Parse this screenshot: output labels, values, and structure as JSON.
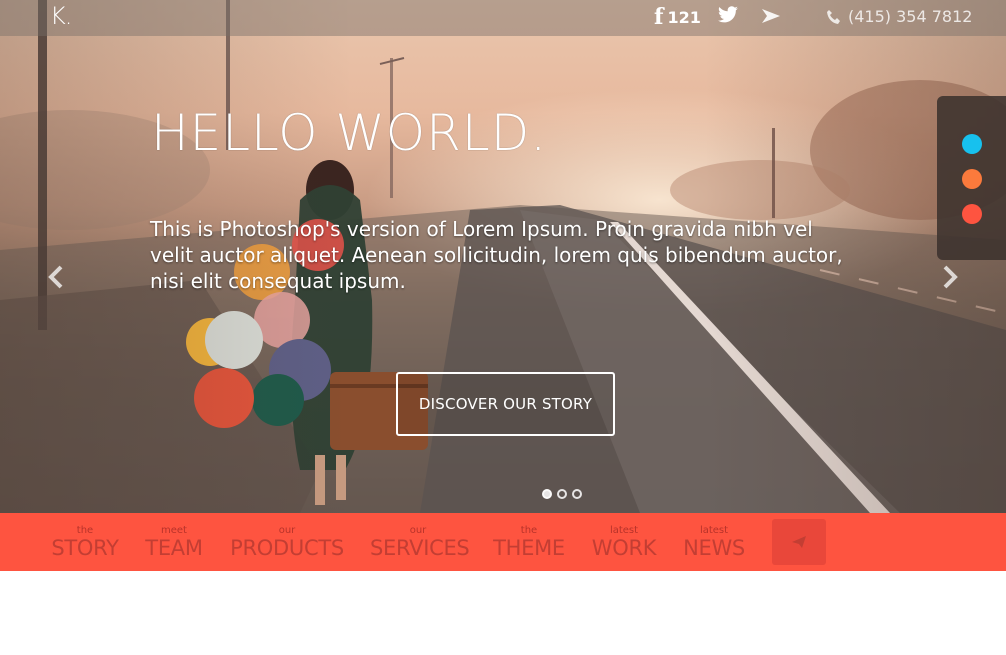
{
  "topbar": {
    "logo": "K.",
    "facebook_count": "121",
    "phone": "(415) 354 7812"
  },
  "colors": {
    "swatches": [
      "#17c1ee",
      "#fb7a3c",
      "#fe5440"
    ]
  },
  "hero": {
    "title": "HELLO WORLD.",
    "text": "This is Photoshop's version of Lorem Ipsum. Proin gravida nibh vel velit auctor aliquet. Aenean sollicitudin, lorem quis bibendum auctor, nisi elit consequat ipsum.",
    "cta_label": "DISCOVER OUR STORY",
    "slide_count": 3,
    "active_slide": 1
  },
  "nav": {
    "items": [
      {
        "small": "the",
        "big": "STORY"
      },
      {
        "small": "meet",
        "big": "TEAM"
      },
      {
        "small": "our",
        "big": "PRODUCTS"
      },
      {
        "small": "our",
        "big": "SERVICES"
      },
      {
        "small": "the",
        "big": "THEME"
      },
      {
        "small": "latest",
        "big": "WORK"
      },
      {
        "small": "latest",
        "big": "NEWS"
      }
    ]
  },
  "icons": {
    "facebook": "facebook-icon",
    "twitter": "twitter-icon",
    "plane": "paper-plane-icon",
    "phone": "phone-icon",
    "prev": "chevron-left-icon",
    "next": "chevron-right-icon",
    "send": "send-icon"
  },
  "accent": "#fe5440"
}
